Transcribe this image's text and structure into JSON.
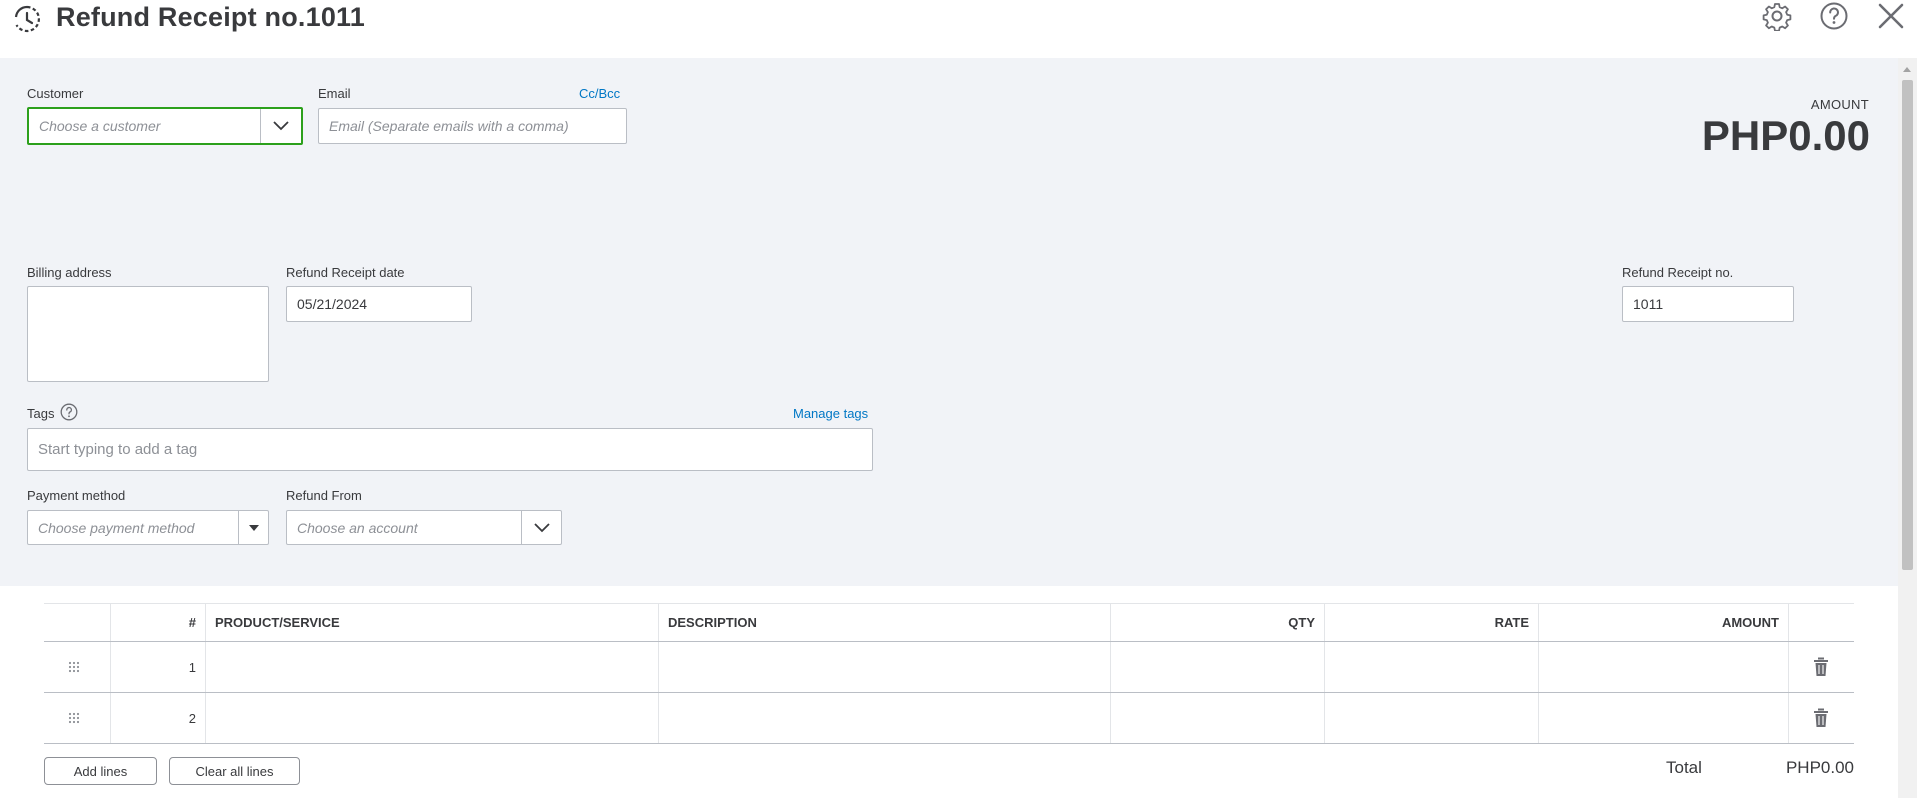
{
  "header": {
    "title": "Refund Receipt no.1011"
  },
  "customer": {
    "label": "Customer",
    "placeholder": "Choose a customer"
  },
  "email": {
    "label": "Email",
    "cc_bcc": "Cc/Bcc",
    "placeholder": "Email (Separate emails with a comma)"
  },
  "amount": {
    "label": "AMOUNT",
    "value": "PHP0.00"
  },
  "billing": {
    "label": "Billing address"
  },
  "refund_date": {
    "label": "Refund Receipt date",
    "value": "05/21/2024"
  },
  "refund_no": {
    "label": "Refund Receipt no.",
    "value": "1011"
  },
  "tags": {
    "label": "Tags",
    "manage": "Manage tags",
    "placeholder": "Start typing to add a tag"
  },
  "payment_method": {
    "label": "Payment method",
    "placeholder": "Choose payment method"
  },
  "refund_from": {
    "label": "Refund From",
    "placeholder": "Choose an account"
  },
  "table": {
    "columns": [
      "#",
      "PRODUCT/SERVICE",
      "DESCRIPTION",
      "QTY",
      "RATE",
      "AMOUNT"
    ],
    "rows": [
      {
        "num": "1"
      },
      {
        "num": "2"
      }
    ]
  },
  "footer": {
    "add_lines": "Add lines",
    "clear_lines": "Clear all lines",
    "total_label": "Total",
    "total_value": "PHP0.00"
  },
  "colors": {
    "accent_green": "#2ca01c",
    "link_blue": "#0077c5",
    "form_bg": "#f1f3f7"
  }
}
